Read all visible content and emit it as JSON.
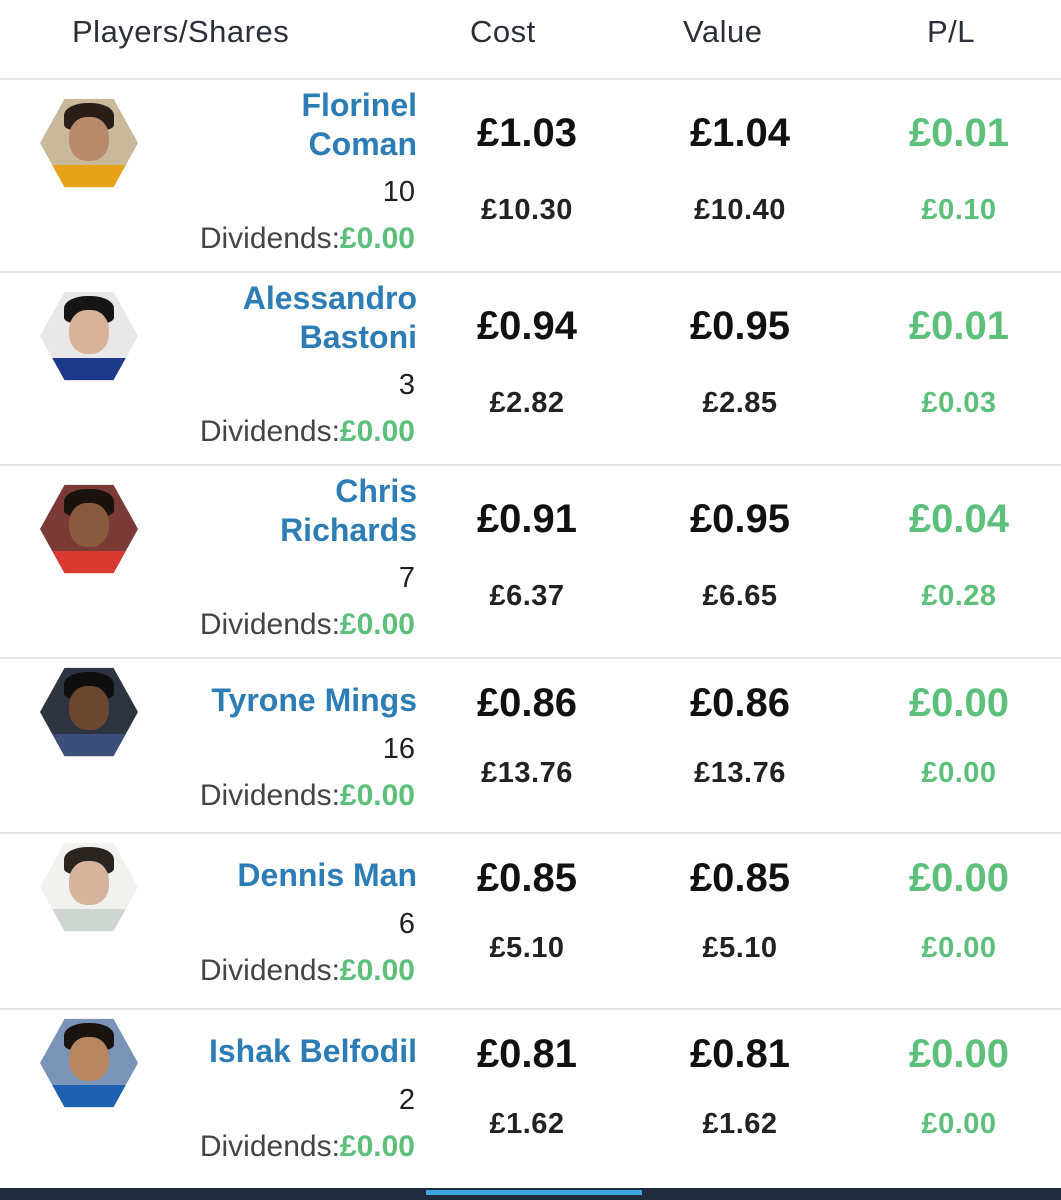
{
  "header": {
    "players": "Players/Shares",
    "cost": "Cost",
    "value": "Value",
    "pl": "P/L"
  },
  "dividends_label": "Dividends:",
  "colors": {
    "name_blue": "#2c7cb5",
    "profit_green": "#5cbf7a"
  },
  "players": [
    {
      "name_line1": "Florinel",
      "name_line2": "Coman",
      "shares": "10",
      "dividends": "£0.00",
      "cost_unit": "£1.03",
      "cost_total": "£10.30",
      "value_unit": "£1.04",
      "value_total": "£10.40",
      "pl_unit": "£0.01",
      "pl_total": "£0.10"
    },
    {
      "name_line1": "Alessandro",
      "name_line2": "Bastoni",
      "shares": "3",
      "dividends": "£0.00",
      "cost_unit": "£0.94",
      "cost_total": "£2.82",
      "value_unit": "£0.95",
      "value_total": "£2.85",
      "pl_unit": "£0.01",
      "pl_total": "£0.03"
    },
    {
      "name_line1": "Chris",
      "name_line2": "Richards",
      "shares": "7",
      "dividends": "£0.00",
      "cost_unit": "£0.91",
      "cost_total": "£6.37",
      "value_unit": "£0.95",
      "value_total": "£6.65",
      "pl_unit": "£0.04",
      "pl_total": "£0.28"
    },
    {
      "name_line1": "Tyrone Mings",
      "shares": "16",
      "dividends": "£0.00",
      "cost_unit": "£0.86",
      "cost_total": "£13.76",
      "value_unit": "£0.86",
      "value_total": "£13.76",
      "pl_unit": "£0.00",
      "pl_total": "£0.00"
    },
    {
      "name_line1": "Dennis Man",
      "shares": "6",
      "dividends": "£0.00",
      "cost_unit": "£0.85",
      "cost_total": "£5.10",
      "value_unit": "£0.85",
      "value_total": "£5.10",
      "pl_unit": "£0.00",
      "pl_total": "£0.00"
    },
    {
      "name_line1": "Ishak Belfodil",
      "shares": "2",
      "dividends": "£0.00",
      "cost_unit": "£0.81",
      "cost_total": "£1.62",
      "value_unit": "£0.81",
      "value_total": "£1.62",
      "pl_unit": "£0.00",
      "pl_total": "£0.00"
    }
  ]
}
